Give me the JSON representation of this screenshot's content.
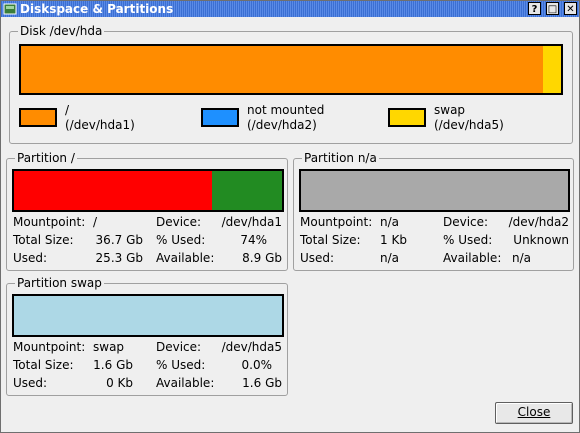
{
  "window": {
    "title": "Diskspace & Partitions"
  },
  "title_buttons": {
    "help": "?",
    "maximize": "□",
    "close": "✕"
  },
  "disk": {
    "title": "Disk /dev/hda",
    "segments": [
      {
        "name": "/",
        "fraction": 0.967,
        "color": "#ff8c00"
      },
      {
        "name": "swap",
        "fraction": 0.033,
        "color": "#ffd700"
      }
    ],
    "legend": [
      {
        "line1": "/",
        "line2": "(/dev/hda1)",
        "color": "#ff8c00"
      },
      {
        "line1": "not mounted",
        "line2": "(/dev/hda2)",
        "color": "#1e90ff"
      },
      {
        "line1": "swap",
        "line2": "(/dev/hda5)",
        "color": "#ffd700"
      }
    ]
  },
  "partitions": [
    {
      "title": "Partition /",
      "used_fraction": 0.74,
      "used_color": "#ff0000",
      "free_color": "#228b22",
      "labels": {
        "mountpoint": "Mountpoint:",
        "device": "Device:",
        "total": "Total Size:",
        "pused": "% Used:",
        "used": "Used:",
        "available": "Available:"
      },
      "mountpoint": "/",
      "device": "/dev/hda1",
      "total": "36.7 Gb",
      "pused": "74%",
      "used": "25.3 Gb",
      "available": "8.9 Gb"
    },
    {
      "title": "Partition n/a",
      "used_fraction": 1.0,
      "used_color": "#a9a9a9",
      "free_color": "#a9a9a9",
      "labels": {
        "mountpoint": "Mountpoint:",
        "device": "Device:",
        "total": "Total Size:",
        "pused": "% Used:",
        "used": "Used:",
        "available": "Available:"
      },
      "mountpoint": "n/a",
      "device": "/dev/hda2",
      "total": "1 Kb",
      "pused": "Unknown",
      "used": "n/a",
      "available": "n/a"
    },
    {
      "title": "Partition swap",
      "used_fraction": 1.0,
      "used_color": "#add8e6",
      "free_color": "#add8e6",
      "labels": {
        "mountpoint": "Mountpoint:",
        "device": "Device:",
        "total": "Total Size:",
        "pused": "% Used:",
        "used": "Used:",
        "available": "Available:"
      },
      "mountpoint": "swap",
      "device": "/dev/hda5",
      "total": "1.6 Gb",
      "pused": "0.0%",
      "used": "0 Kb",
      "available": "1.6 Gb"
    }
  ],
  "buttons": {
    "close": "Close"
  }
}
